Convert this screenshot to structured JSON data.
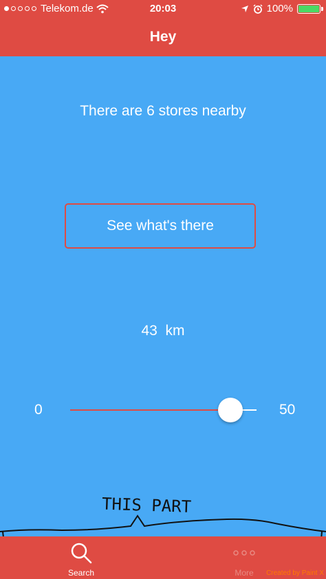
{
  "status_bar": {
    "carrier": "Telekom.de",
    "time": "20:03",
    "battery": "100%",
    "signal_dots_filled": 1,
    "signal_dots_total": 5
  },
  "nav": {
    "title": "Hey"
  },
  "main": {
    "stores_text": "There are 6 stores nearby",
    "see_button_label": "See what's there",
    "distance_text": "43  km"
  },
  "slider": {
    "min_label": "0",
    "max_label": "50",
    "value": 43,
    "min": 0,
    "max": 50
  },
  "annotation": {
    "text": "THIS PART"
  },
  "tab_bar": {
    "search_label": "Search",
    "more_label": "More"
  },
  "watermark": "Created by Paint X",
  "colors": {
    "accent_red": "#df4b43",
    "background_blue": "#48a9f5",
    "battery_green": "#4cd964"
  }
}
